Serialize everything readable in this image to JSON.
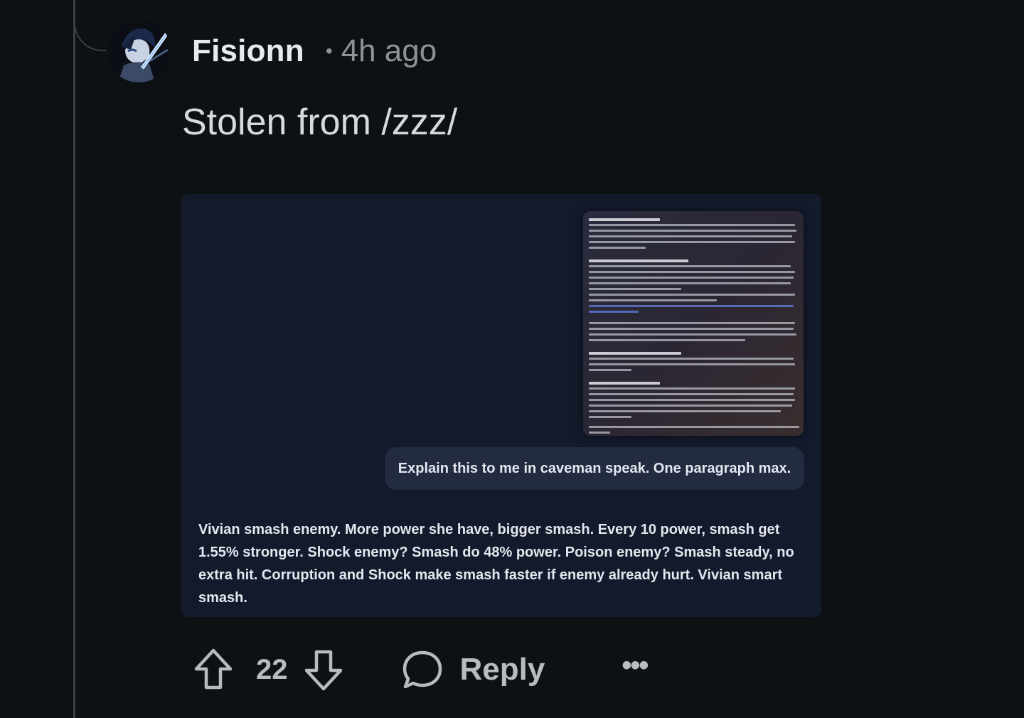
{
  "comment": {
    "author": "Fisionn",
    "separator": "•",
    "timestamp": "4h ago",
    "text": "Stolen from /zzz/",
    "avatar_icon": "anime-character-avatar"
  },
  "media": {
    "document_icon": "document-screenshot",
    "prompt": "Explain this to me in caveman speak. One paragraph max.",
    "answer": "Vivian smash enemy. More power she have, bigger smash. Every 10 power, smash get 1.55% stronger. Shock enemy? Smash do 48% power. Poison enemy? Smash steady, no extra hit. Corruption and Shock make smash faster if enemy already hurt. Vivian smart smash."
  },
  "actions": {
    "upvote_icon": "arrow-up-icon",
    "score": "22",
    "downvote_icon": "arrow-down-icon",
    "reply_icon": "speech-bubble-icon",
    "reply_label": "Reply",
    "more_label": "•••"
  },
  "colors": {
    "background": "#0e1113",
    "card": "#131a2b",
    "bubble": "#232b41",
    "muted": "#8b9399"
  }
}
